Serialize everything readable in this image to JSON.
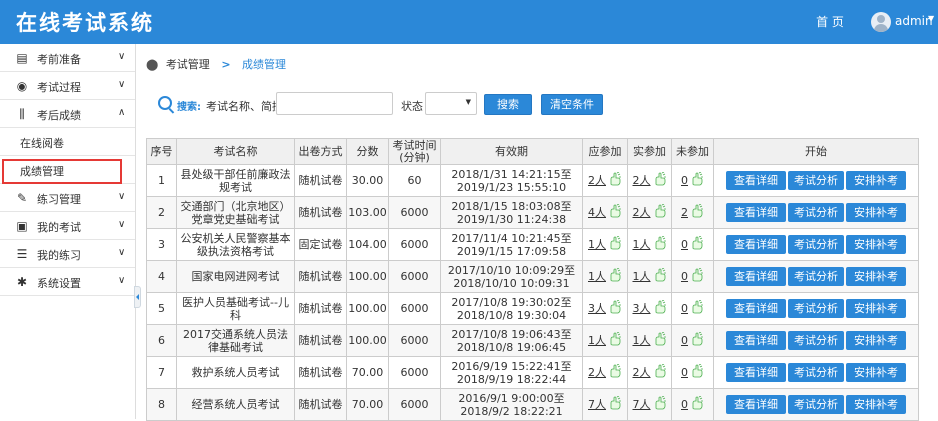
{
  "app": {
    "title": "在线考试系统"
  },
  "header": {
    "home": "首 页",
    "user": "admin"
  },
  "sidebar": {
    "items": [
      {
        "label": "考前准备",
        "icon": "document-icon",
        "chevron": "∨"
      },
      {
        "label": "考试过程",
        "icon": "eye-icon",
        "chevron": "∨"
      },
      {
        "label": "考后成绩",
        "icon": "sliders-icon",
        "chevron": "∧"
      },
      {
        "label": "练习管理",
        "icon": "wrench-icon",
        "chevron": "∨"
      },
      {
        "label": "我的考试",
        "icon": "clipboard-icon",
        "chevron": "∨"
      },
      {
        "label": "我的练习",
        "icon": "list-icon",
        "chevron": "∨"
      },
      {
        "label": "系统设置",
        "icon": "gear-icon",
        "chevron": "∨"
      }
    ],
    "sub_items": [
      "在线阅卷",
      "成绩管理"
    ]
  },
  "breadcrumb": {
    "parent": "考试管理",
    "separator": ">",
    "current": "成绩管理"
  },
  "search": {
    "label": "搜索:",
    "name_label": "考试名称、简拼",
    "name_value": "",
    "status_label": "状态",
    "status_value": "",
    "search_button": "搜索",
    "clear_button": "清空条件"
  },
  "table": {
    "headers": [
      "序号",
      "考试名称",
      "出卷方式",
      "分数",
      "考试时间\n(分钟)",
      "有效期",
      "应参加",
      "实参加",
      "未参加",
      "开始"
    ],
    "actions": [
      "查看详细",
      "考试分析",
      "安排补考"
    ],
    "rows": [
      {
        "no": "1",
        "name": "县处级干部任前廉政法规考试",
        "mode": "随机试卷",
        "score": "30.00",
        "time": "60",
        "period": "2018/1/31 14:21:15至2019/1/23 15:55:10",
        "should": "2人",
        "actual": "2人",
        "absent": "0"
      },
      {
        "no": "2",
        "name": "交通部门（北京地区）党章党史基础考试",
        "mode": "随机试卷",
        "score": "103.00",
        "time": "6000",
        "period": "2018/1/15 18:03:08至2019/1/30 11:24:38",
        "should": "4人",
        "actual": "2人",
        "absent": "2"
      },
      {
        "no": "3",
        "name": "公安机关人民警察基本级执法资格考试",
        "mode": "固定试卷",
        "score": "104.00",
        "time": "6000",
        "period": "2017/11/4 10:21:45至2019/1/15 17:09:58",
        "should": "1人",
        "actual": "1人",
        "absent": "0"
      },
      {
        "no": "4",
        "name": "国家电网进网考试",
        "mode": "随机试卷",
        "score": "100.00",
        "time": "6000",
        "period": "2017/10/10 10:09:29至2018/10/10 10:09:31",
        "should": "1人",
        "actual": "1人",
        "absent": "0"
      },
      {
        "no": "5",
        "name": "医护人员基础考试--儿科",
        "mode": "随机试卷",
        "score": "100.00",
        "time": "6000",
        "period": "2017/10/8 19:30:02至2018/10/8 19:30:04",
        "should": "3人",
        "actual": "3人",
        "absent": "0"
      },
      {
        "no": "6",
        "name": "2017交通系统人员法律基础考试",
        "mode": "随机试卷",
        "score": "100.00",
        "time": "6000",
        "period": "2017/10/8 19:06:43至2018/10/8 19:06:45",
        "should": "1人",
        "actual": "1人",
        "absent": "0"
      },
      {
        "no": "7",
        "name": "救护系统人员考试",
        "mode": "随机试卷",
        "score": "70.00",
        "time": "6000",
        "period": "2016/9/19 15:22:41至2018/9/19 18:22:44",
        "should": "2人",
        "actual": "2人",
        "absent": "0"
      },
      {
        "no": "8",
        "name": "经营系统人员考试",
        "mode": "随机试卷",
        "score": "70.00",
        "time": "6000",
        "period": "2016/9/1 9:00:00至2018/9/2 18:22:21",
        "should": "7人",
        "actual": "7人",
        "absent": "0"
      }
    ]
  }
}
